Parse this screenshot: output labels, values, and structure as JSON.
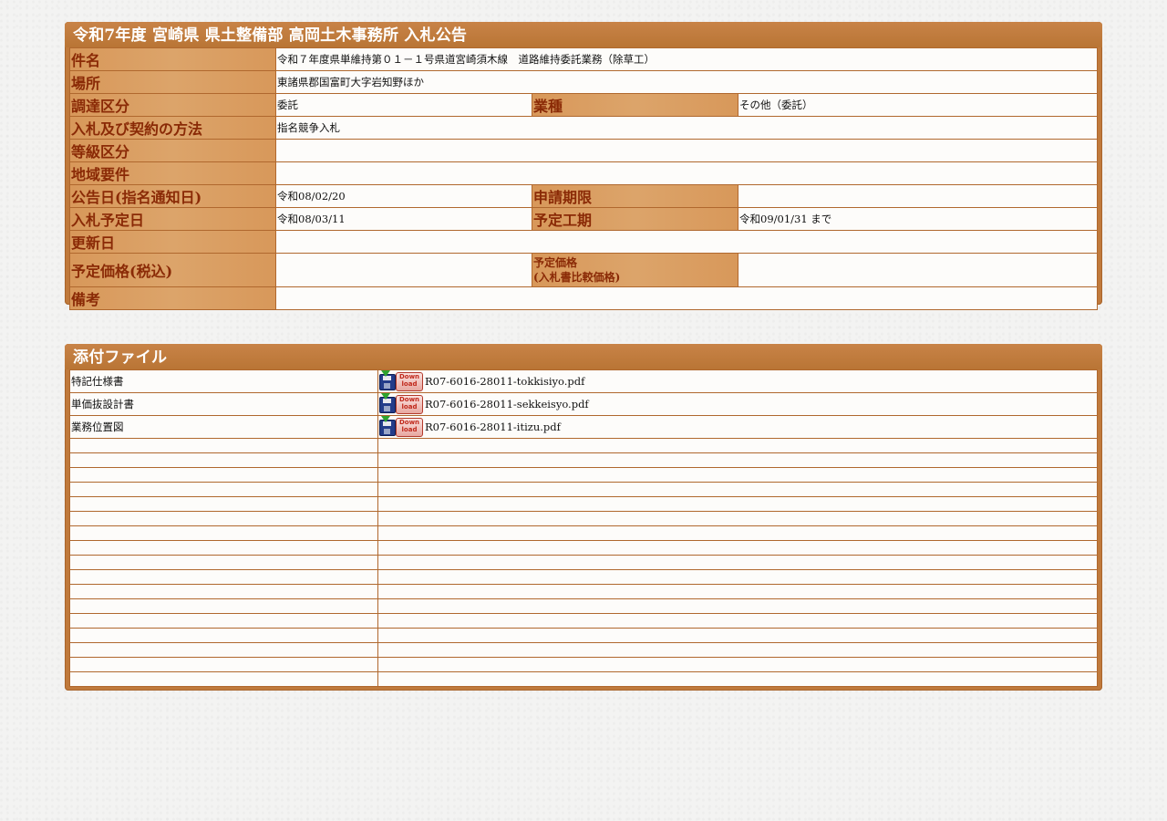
{
  "notice": {
    "title": "令和7年度  宮崎県  県土整備部  高岡土木事務所  入札公告",
    "rows": {
      "kenmei": {
        "label": "件名",
        "value": "令和７年度県単維持第０１－１号県道宮崎須木線　道路維持委託業務（除草工）"
      },
      "basho": {
        "label": "場所",
        "value": "東諸県郡国富町大字岩知野ほか"
      },
      "chotatsu": {
        "label": "調達区分",
        "value": "委託"
      },
      "gyoshu": {
        "label": "業種",
        "value": "その他（委託）"
      },
      "hoho": {
        "label": "入札及び契約の方法",
        "value": "指名競争入札"
      },
      "tokyu": {
        "label": "等級区分",
        "value": ""
      },
      "chiiki": {
        "label": "地域要件",
        "value": ""
      },
      "kokokubi": {
        "label": "公告日(指名通知日)",
        "value": "令和08/02/20"
      },
      "shinsei": {
        "label": "申請期限",
        "value": ""
      },
      "nyusatsubi": {
        "label": "入札予定日",
        "value": "令和08/03/11"
      },
      "koki": {
        "label": "予定工期",
        "value": "令和09/01/31 まで"
      },
      "koshin": {
        "label": "更新日",
        "value": ""
      },
      "yotei_kakaku": {
        "label": "予定価格(税込)",
        "value": ""
      },
      "hikaku_kakaku": {
        "label_line1": "予定価格",
        "label_line2": "(入札書比較価格)",
        "value": ""
      },
      "biko": {
        "label": "備考",
        "value": ""
      }
    }
  },
  "attachments": {
    "title": "添付ファイル",
    "download_icon_text_top": "Down",
    "download_icon_text_bottom": "load",
    "files": [
      {
        "name": "特記仕様書",
        "file": "R07-6016-28011-tokkisiyo.pdf"
      },
      {
        "name": "単価抜設計書",
        "file": "R07-6016-28011-sekkeisyo.pdf"
      },
      {
        "name": "業務位置図",
        "file": "R07-6016-28011-itizu.pdf"
      }
    ],
    "empty_row_count": 17
  }
}
